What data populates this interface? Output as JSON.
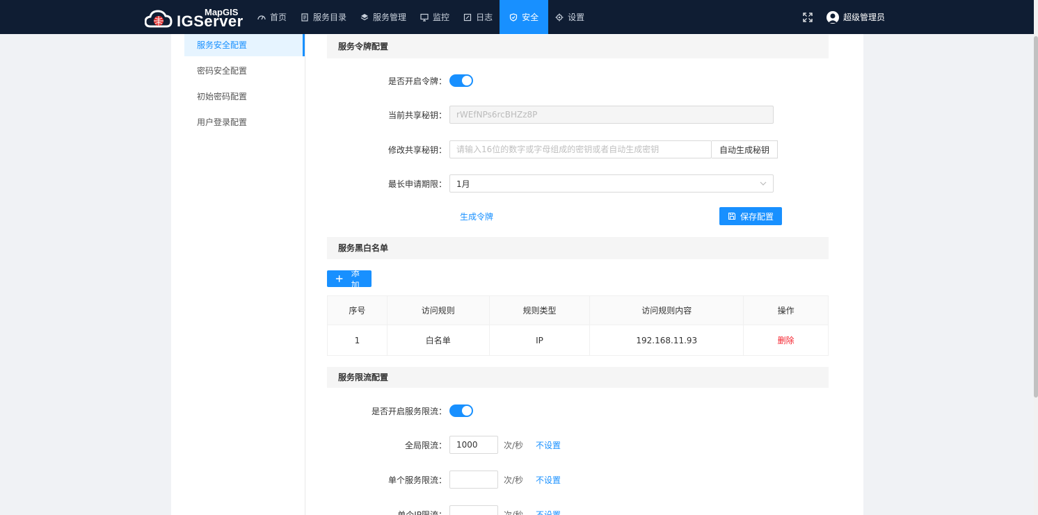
{
  "brand": {
    "small": "MapGIS",
    "big": "IGServer"
  },
  "nav": [
    {
      "label": "首页",
      "icon": "dashboard-icon"
    },
    {
      "label": "服务目录",
      "icon": "catalog-icon"
    },
    {
      "label": "服务管理",
      "icon": "layers-icon"
    },
    {
      "label": "监控",
      "icon": "monitor-icon"
    },
    {
      "label": "日志",
      "icon": "log-icon"
    },
    {
      "label": "安全",
      "icon": "shield-icon",
      "active": true
    },
    {
      "label": "设置",
      "icon": "gear-icon"
    }
  ],
  "user": {
    "name": "超级管理员"
  },
  "sidebar": {
    "items": [
      {
        "label": "服务安全配置",
        "active": true
      },
      {
        "label": "密码安全配置"
      },
      {
        "label": "初始密码配置"
      },
      {
        "label": "用户登录配置"
      }
    ]
  },
  "token": {
    "title": "服务令牌配置",
    "enable_label": "是否开启令牌：",
    "enabled": true,
    "current_secret_label": "当前共享秘钥：",
    "current_secret_value": "rWEfNPs6rcBHZz8P",
    "modify_secret_label": "修改共享秘钥：",
    "modify_secret_placeholder": "请输入16位的数字或字母组成的密钥或者自动生成密钥",
    "auto_generate_label": "自动生成秘钥",
    "max_period_label": "最长申请期限：",
    "max_period_value": "1月",
    "generate_token_label": "生成令牌",
    "save_label": "保存配置"
  },
  "blacklist": {
    "title": "服务黑白名单",
    "add_label": "添加",
    "columns": [
      "序号",
      "访问规则",
      "规则类型",
      "访问规则内容",
      "操作"
    ],
    "rows": [
      {
        "index": "1",
        "rule": "白名单",
        "type": "IP",
        "content": "192.168.11.93",
        "action": "删除"
      }
    ]
  },
  "ratelimit": {
    "title": "服务限流配置",
    "enable_label": "是否开启服务限流：",
    "enabled": true,
    "global_label": "全局限流：",
    "global_value": "1000",
    "single_service_label": "单个服务限流：",
    "single_service_value": "",
    "single_ip_label": "单个IP限流：",
    "single_ip_value": "",
    "unit": "次/秒",
    "unset_label": "不设置"
  },
  "colors": {
    "accent": "#1890ff",
    "nav_bg": "#0f1d33",
    "danger": "#f5222d"
  }
}
